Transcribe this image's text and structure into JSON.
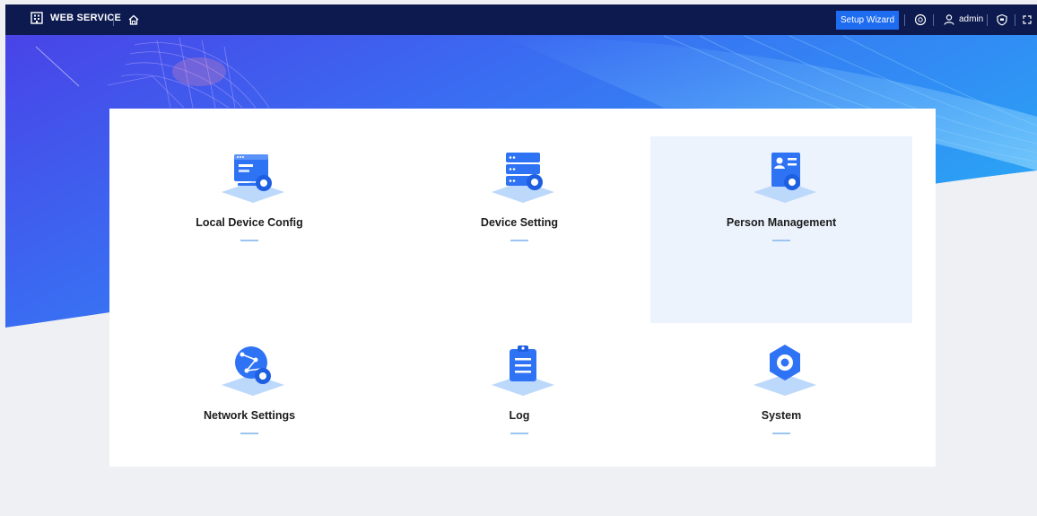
{
  "header": {
    "title": "WEB SERVICE",
    "setup_wizard_label": "Setup Wizard",
    "user_name": "admin",
    "icons": [
      "building-logo-icon",
      "home-icon",
      "help-icon",
      "user-icon",
      "shield-icon",
      "fullscreen-icon"
    ]
  },
  "menu": [
    {
      "label": "Local Device Config",
      "icon": "monitor-gear-icon",
      "highlighted": false
    },
    {
      "label": "Device Setting",
      "icon": "server-gear-icon",
      "highlighted": false
    },
    {
      "label": "Person Management",
      "icon": "person-card-gear-icon",
      "highlighted": true
    },
    {
      "label": "Network Settings",
      "icon": "globe-network-gear-icon",
      "highlighted": false
    },
    {
      "label": "Log",
      "icon": "clipboard-icon",
      "highlighted": false
    },
    {
      "label": "System",
      "icon": "hexagon-gear-icon",
      "highlighted": false
    }
  ],
  "colors": {
    "topbar": "#0c1a4f",
    "accent": "#1e6cf0",
    "icon_blue": "#2f73f5",
    "highlight": "#ecf3fd"
  }
}
